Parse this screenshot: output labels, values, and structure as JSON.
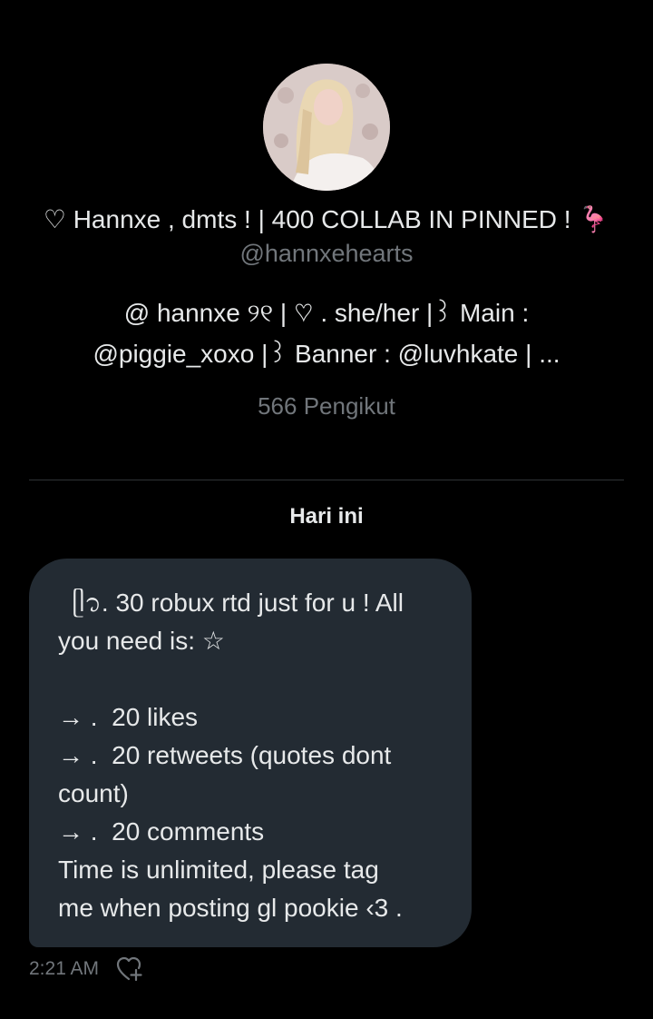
{
  "profile": {
    "display_name": "♡ Hannxe , dmts ! | 400 COLLAB IN PINNED ! 🦩",
    "handle": "@hannxehearts",
    "bio_lines": [
      "@ hannxe   ୨୧ |  ♡ . she/her  |꒱ Main :",
      "@piggie_xoxo   |꒱ Banner : @luvhkate  | ..."
    ],
    "followers": "566 Pengikut"
  },
  "conversation": {
    "date_separator": "Hari ini",
    "message": {
      "lines": [
        "  ᥫ᭡. 30 robux rtd just for u ! All",
        "you need is: ☆",
        "",
        "→ .  20 likes",
        "→ .  20 retweets (quotes dont",
        "count)",
        "→ .  20 comments",
        "Time is unlimited, please tag",
        "me when posting gl pookie ‹3 ."
      ],
      "timestamp": "2:21 AM"
    }
  },
  "icons": {
    "avatar": "profile-photo",
    "reaction": "add-reaction-heart-icon"
  },
  "colors": {
    "background": "#000000",
    "bubble": "#232b33",
    "primary_text": "#e7e9ea",
    "secondary_text": "#71767b",
    "divider": "#2f3336"
  }
}
